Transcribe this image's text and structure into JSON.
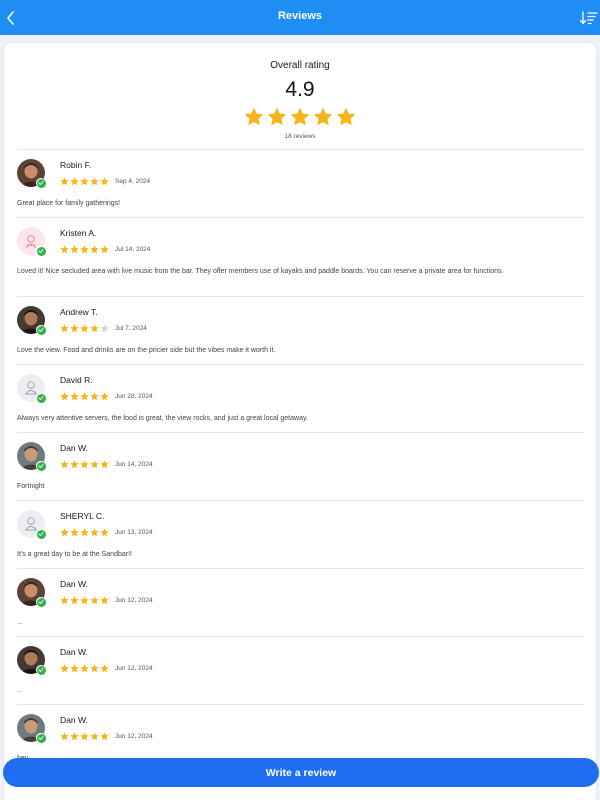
{
  "header": {
    "title": "Reviews",
    "back_icon": "chevron-left-icon",
    "sort_icon": "sort-descending-icon",
    "color": "#1e8ef5"
  },
  "summary": {
    "label": "Overall rating",
    "value": "4.9",
    "stars": 5,
    "count": "18 reviews"
  },
  "star_color": "#f6b419",
  "reviews": [
    {
      "name": "Robin F.",
      "rating": 5,
      "date": "Sep 4, 2024",
      "text": "Great place for family gatherings!",
      "avatar": "photo",
      "verified": true
    },
    {
      "name": "Kristen A.",
      "rating": 5,
      "date": "Jul 14, 2024",
      "text": "Loved it! Nice secluded area with live music from the bar. They offer members use of kayaks and paddle boards. You can reserve a private area for functions.",
      "avatar": "pink-icon",
      "verified": true
    },
    {
      "name": "Andrew T.",
      "rating": 4,
      "date": "Jul 7, 2024",
      "text": "Love the view. Food and drinks are on the pricier side but the vibes make it worth it.",
      "avatar": "photo",
      "verified": true
    },
    {
      "name": "David R.",
      "rating": 5,
      "date": "Jun 28, 2024",
      "text": "Always very attentive servers, the food is great, the view rocks, and just a great local getaway.",
      "avatar": "default-icon",
      "verified": true
    },
    {
      "name": "Dan W.",
      "rating": 5,
      "date": "Jun 14, 2024",
      "text": "Fortnight",
      "avatar": "photo",
      "verified": true
    },
    {
      "name": "SHERYL C.",
      "rating": 5,
      "date": "Jun 13, 2024",
      "text": "It's a great day to be at the Sandbar!!",
      "avatar": "default-icon",
      "verified": true
    },
    {
      "name": "Dan W.",
      "rating": 5,
      "date": "Jun 12, 2024",
      "text": "...",
      "avatar": "photo",
      "verified": true
    },
    {
      "name": "Dan W.",
      "rating": 5,
      "date": "Jun 12, 2024",
      "text": "..",
      "avatar": "photo",
      "verified": true
    },
    {
      "name": "Dan W.",
      "rating": 5,
      "date": "Jun 12, 2024",
      "text": "hey",
      "avatar": "photo",
      "verified": true
    }
  ],
  "footer": {
    "write_label": "Write a review",
    "color": "#1f6ef0"
  }
}
